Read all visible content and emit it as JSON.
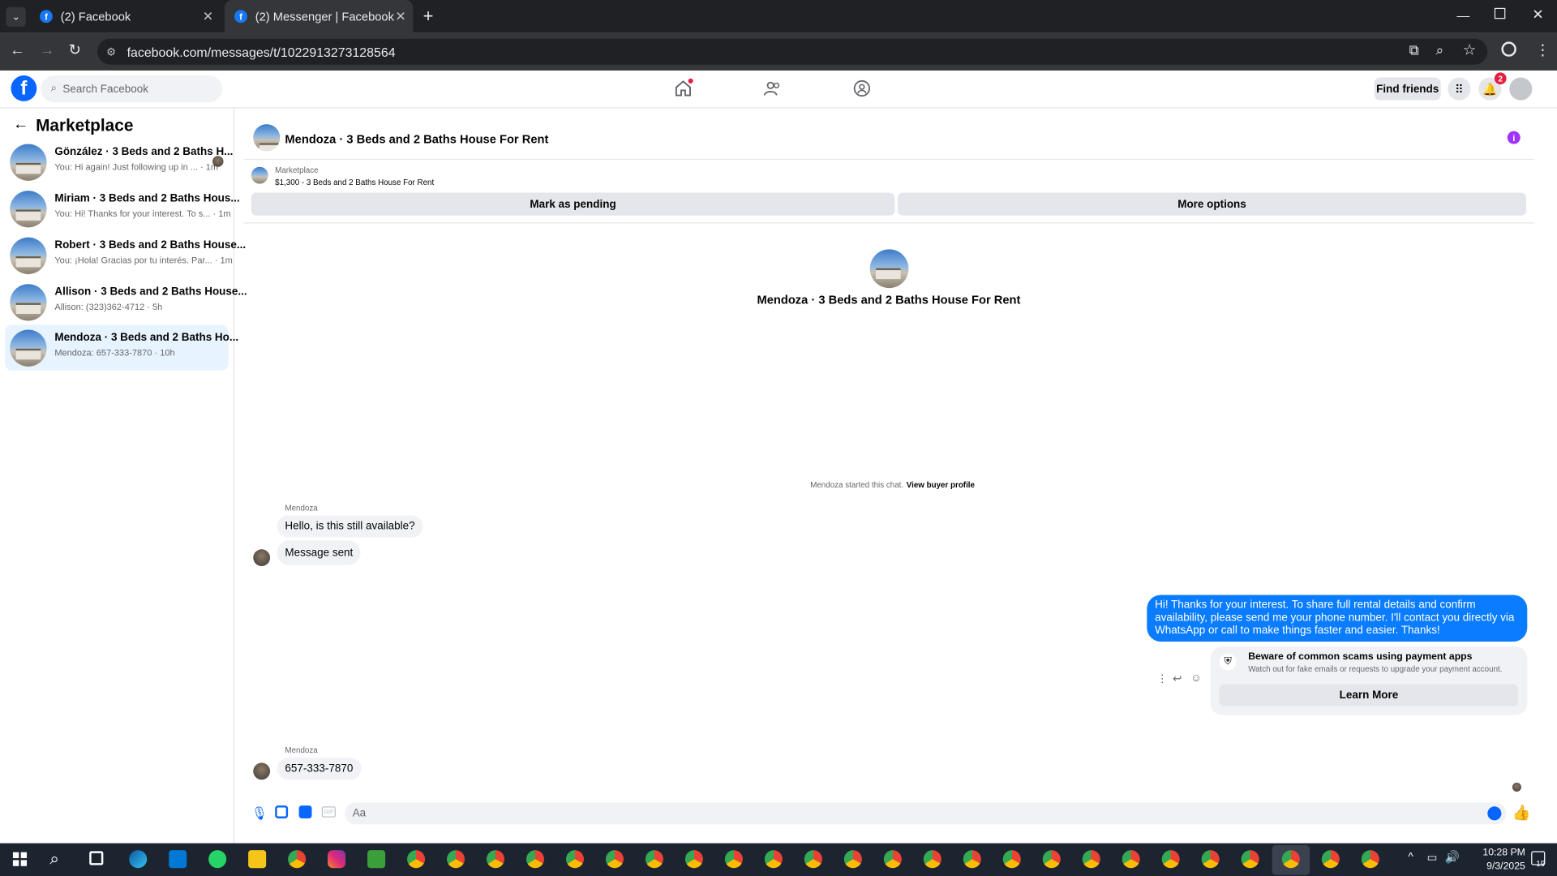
{
  "browser": {
    "tabs": [
      {
        "title": "(2) Facebook"
      },
      {
        "title": "(2) Messenger | Facebook"
      }
    ],
    "url": "facebook.com/messages/t/1022913273128564"
  },
  "fb_header": {
    "search_placeholder": "Search Facebook",
    "find_friends": "Find friends",
    "notification_count": "2"
  },
  "sidebar": {
    "title": "Marketplace",
    "conversations": [
      {
        "name": "Gönzález · 3 Beds and 2 Baths H...",
        "preview": "You: Hi again! Just following up in ... · 1m"
      },
      {
        "name": "Miriam · 3 Beds and 2 Baths Hous...",
        "preview": "You: Hi! Thanks for your interest. To s... · 1m"
      },
      {
        "name": "Robert · 3 Beds and 2 Baths House...",
        "preview": "You: ¡Hola! Gracias por tu interés. Par... · 1m"
      },
      {
        "name": "Allison · 3 Beds and 2 Baths House...",
        "preview": "Allison: (323)362-4712 · 5h"
      },
      {
        "name": "Mendoza · 3 Beds and 2 Baths Ho...",
        "preview": "Mendoza: 657-333-7870 · 10h",
        "selected": true
      }
    ]
  },
  "chat": {
    "title": "Mendoza · 3 Beds and 2 Baths House For Rent",
    "listing": {
      "source": "Marketplace",
      "summary": "$1,300 - 3 Beds and 2 Baths House For Rent"
    },
    "mark_pending": "Mark as pending",
    "more_options": "More options",
    "center_title": "Mendoza · 3 Beds and 2 Baths House For Rent",
    "started_text": "Mendoza started this chat.",
    "view_profile": "View buyer profile",
    "messages": {
      "sender1": "Mendoza",
      "m1": "Hello, is this still available?",
      "m2": "Message sent",
      "outgoing": "Hi! Thanks for your interest. To share full rental details and confirm availability, please send me your phone number. I'll contact you directly via WhatsApp or call to make things faster and easier. Thanks!",
      "sender2": "Mendoza",
      "m3": "657-333-7870"
    },
    "warning": {
      "title": "Beware of common scams using payment apps",
      "body": "Watch out for fake emails or requests to upgrade your payment account.",
      "button": "Learn More"
    },
    "composer_placeholder": "Aa"
  },
  "taskbar": {
    "time": "10:28 PM",
    "date": "9/3/2025",
    "notif": "19"
  },
  "colors": {
    "fb_blue": "#0866ff",
    "bubble_blue": "#0a7cff",
    "selected_bg": "#e7f3ff"
  }
}
